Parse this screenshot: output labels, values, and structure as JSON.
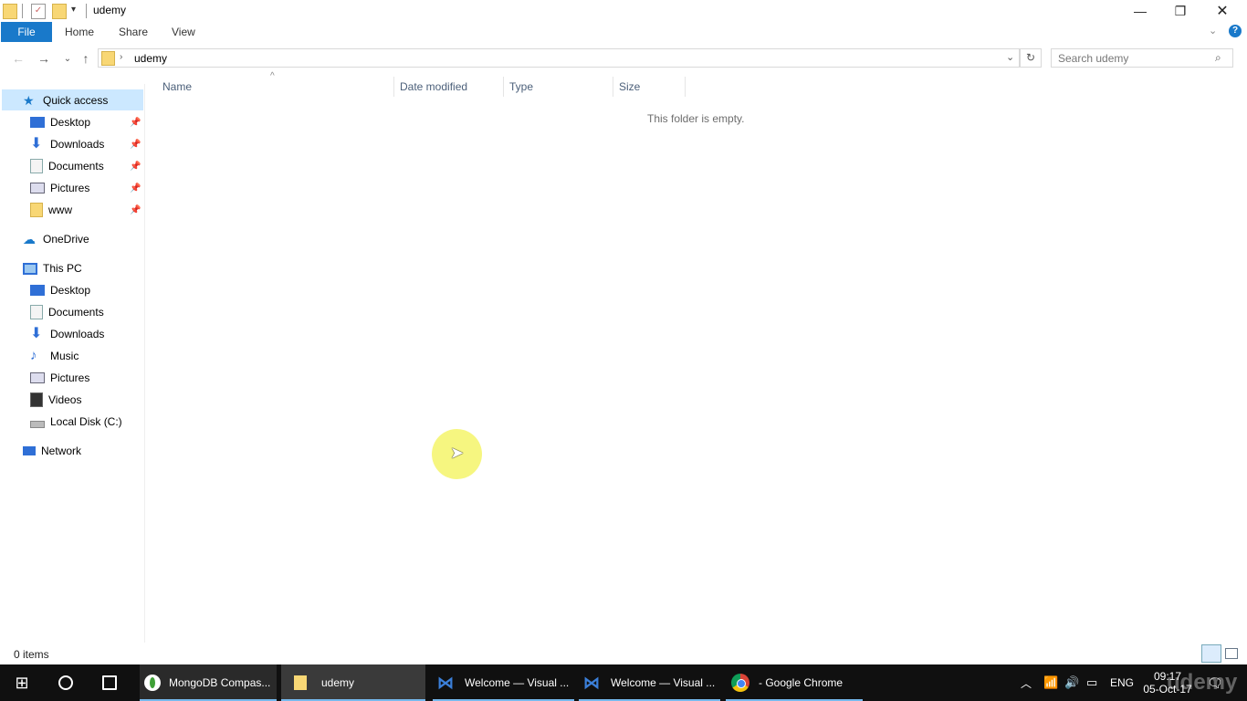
{
  "window": {
    "title": "udemy"
  },
  "ribbon": {
    "tabs": [
      "File",
      "Home",
      "Share",
      "View"
    ]
  },
  "address": {
    "path": "udemy",
    "search_placeholder": "Search udemy"
  },
  "nav": {
    "quick_access": "Quick access",
    "quick_items": [
      "Desktop",
      "Downloads",
      "Documents",
      "Pictures",
      "www"
    ],
    "onedrive": "OneDrive",
    "this_pc": "This PC",
    "pc_items": [
      "Desktop",
      "Documents",
      "Downloads",
      "Music",
      "Pictures",
      "Videos",
      "Local Disk (C:)"
    ],
    "network": "Network"
  },
  "columns": [
    "Name",
    "Date modified",
    "Type",
    "Size"
  ],
  "content": {
    "empty_message": "This folder is empty."
  },
  "status": {
    "items": "0 items"
  },
  "taskbar": {
    "tasks": [
      "MongoDB Compas...",
      "udemy",
      "Welcome — Visual ...",
      "Welcome — Visual ...",
      "- Google Chrome"
    ],
    "lang": "ENG",
    "time": "09:17",
    "date": "05-Oct-17",
    "watermark": "udemy"
  },
  "colors": {
    "accent": "#1979ca",
    "folder": "#f8d775",
    "taskbar": "#101010"
  },
  "icons": [
    "folder-icon",
    "properties-icon",
    "new-folder-icon",
    "back-icon",
    "forward-icon",
    "up-icon",
    "refresh-icon",
    "search-icon",
    "help-icon",
    "start-icon",
    "cortana-icon",
    "task-view-icon",
    "chrome-icon",
    "vs-code-icon",
    "mongodb-icon",
    "network-icon",
    "volume-icon",
    "battery-icon",
    "notification-icon"
  ]
}
